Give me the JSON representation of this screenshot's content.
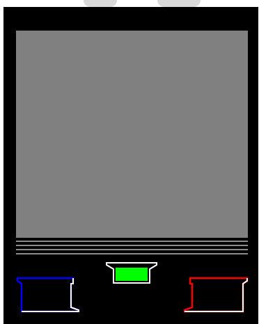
{
  "device": {
    "background_color": "#000000",
    "screen_color": "#808080",
    "scanline_color": "#8c8c8c",
    "outline_color": "#ffffff"
  },
  "buttons": {
    "left": {
      "icon": "blue-slot-icon",
      "fill_color": "#000000",
      "accent_color": "#0000ff"
    },
    "center": {
      "icon": "green-slot-icon",
      "fill_color": "#00ff00",
      "accent_color": "#00ff00"
    },
    "right": {
      "icon": "red-slot-icon",
      "fill_color": "#000000",
      "accent_color": "#ff0000"
    }
  }
}
